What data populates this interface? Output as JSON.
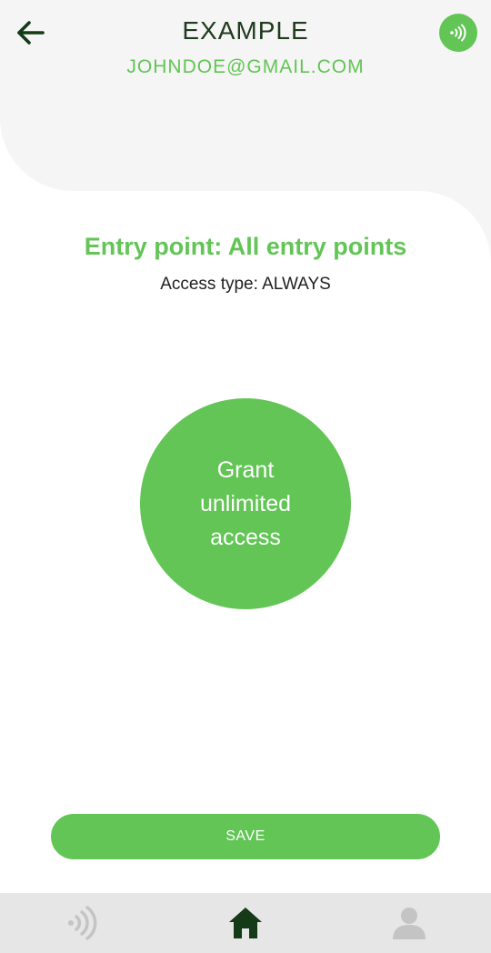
{
  "header": {
    "title": "EXAMPLE",
    "email": "JOHNDOE@GMAIL.COM",
    "back_icon": "arrow-left-icon",
    "nfc_icon": "nfc-signal-icon"
  },
  "main": {
    "entry_point": "Entry point: All entry points",
    "access_type": "Access type: ALWAYS",
    "grant_button_label": "Grant unlimited access"
  },
  "footer": {
    "save_label": "SAVE"
  },
  "bottom_nav": {
    "items": [
      {
        "icon": "nfc-signal-icon",
        "active": false
      },
      {
        "icon": "home-icon",
        "active": true
      },
      {
        "icon": "user-icon",
        "active": false
      }
    ]
  },
  "colors": {
    "accent": "#62c555",
    "title_text": "#1f3a1e",
    "header_bg": "#f5f5f5",
    "nav_bg": "#e6e6e6",
    "nav_active": "#143a17",
    "nav_inactive": "#c4c4c4"
  }
}
